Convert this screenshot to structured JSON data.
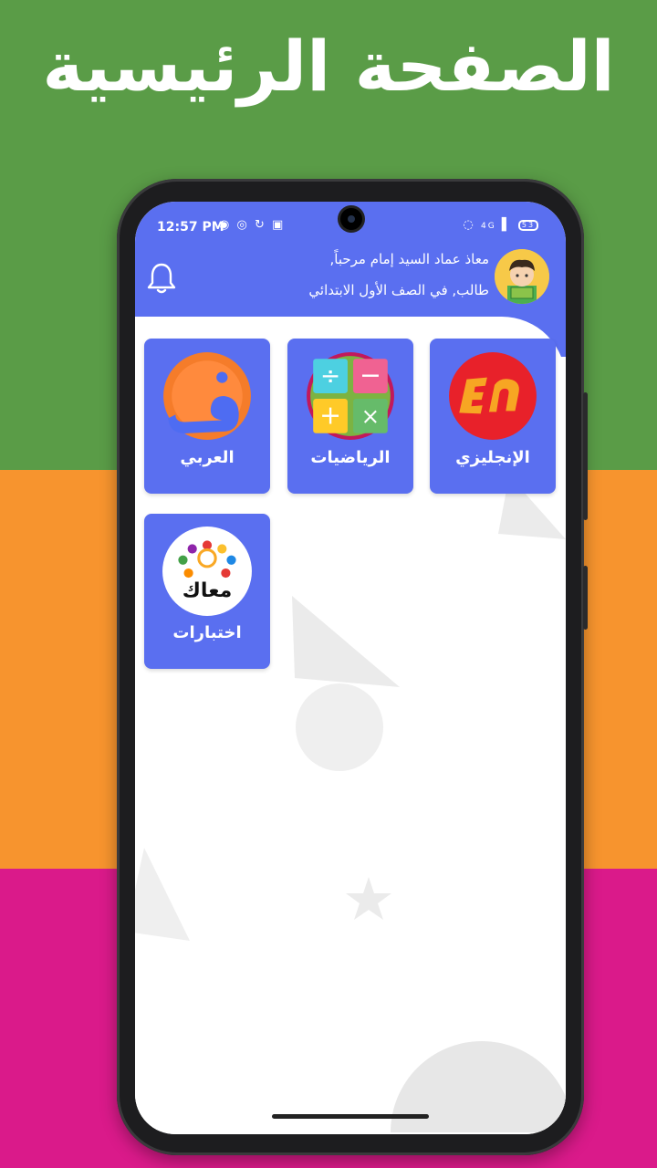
{
  "promo": {
    "title": "الصفحة الرئيسية",
    "band_colors": {
      "top": "#5a9c47",
      "middle": "#f7942e",
      "bottom": "#da1a8a"
    }
  },
  "status_bar": {
    "time": "12:57 PM",
    "left_icons": [
      "wifi-calling-icon",
      "hotspot-icon",
      "sync-icon",
      "app-icon"
    ],
    "right_icons": [
      "chat-icon",
      "4g-signal-icon",
      "wifi-signal-icon",
      "battery-icon"
    ],
    "network": "4G",
    "battery": "53"
  },
  "header": {
    "greeting_line1": "معاذ عماد السيد إمام مرحباً,",
    "greeting_line2": "طالب, في الصف الأول الابتدائي",
    "accent_color": "#5a6ff0"
  },
  "subjects": [
    {
      "label": "الإنجليزي",
      "icon": "english-en-icon"
    },
    {
      "label": "الرياضيات",
      "icon": "math-operations-icon"
    },
    {
      "label": "العربي",
      "icon": "arabic-dad-letter-icon"
    },
    {
      "label": "اختبارات",
      "icon": "maak-logo-icon",
      "logo_text": "معاك"
    }
  ]
}
